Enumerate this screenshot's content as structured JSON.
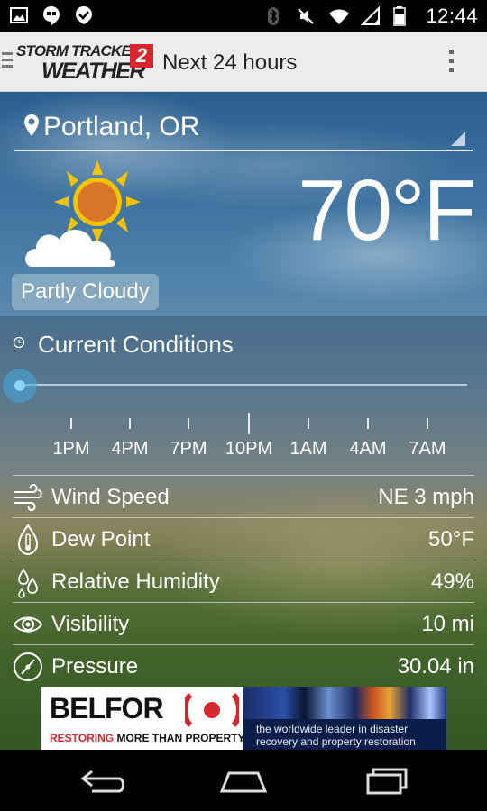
{
  "status_bar": {
    "time": "12:44",
    "left_icons": [
      "image-icon",
      "hangouts-icon",
      "check-shield-icon"
    ],
    "right_icons": [
      "bluetooth-icon",
      "mute-icon",
      "wifi-icon",
      "signal-icon",
      "battery-icon"
    ]
  },
  "app_bar": {
    "logo_line1": "STORM TRACKER",
    "logo_line2": "WEATHER",
    "logo_number": "2",
    "title": "Next 24 hours"
  },
  "location": {
    "label": "Portland, OR"
  },
  "current": {
    "temperature": "70°F",
    "condition": "Partly Cloudy"
  },
  "conditions_header": "Current Conditions",
  "timeline": {
    "labels": [
      "1PM",
      "4PM",
      "7PM",
      "10PM",
      "1AM",
      "4AM",
      "7AM"
    ],
    "position": 0
  },
  "details": [
    {
      "icon": "wind-icon",
      "label": "Wind Speed",
      "value": "NE 3 mph"
    },
    {
      "icon": "thermometer-icon",
      "label": "Dew Point",
      "value": "50°F"
    },
    {
      "icon": "humidity-icon",
      "label": "Relative Humidity",
      "value": "49%"
    },
    {
      "icon": "eye-icon",
      "label": "Visibility",
      "value": "10 mi"
    },
    {
      "icon": "pressure-gauge-icon",
      "label": "Pressure",
      "value": "30.04 in"
    }
  ],
  "ad": {
    "brand": "BELFOR",
    "tagline_red": "RESTORING",
    "tagline_rest": " MORE THAN PROPERTY",
    "right_line1": "the worldwide leader in disaster",
    "right_line2": "recovery and property restoration"
  },
  "colors": {
    "accent_blue": "#46aadc",
    "brand_red": "#d8262e",
    "appbar_bg": "#ececec"
  }
}
